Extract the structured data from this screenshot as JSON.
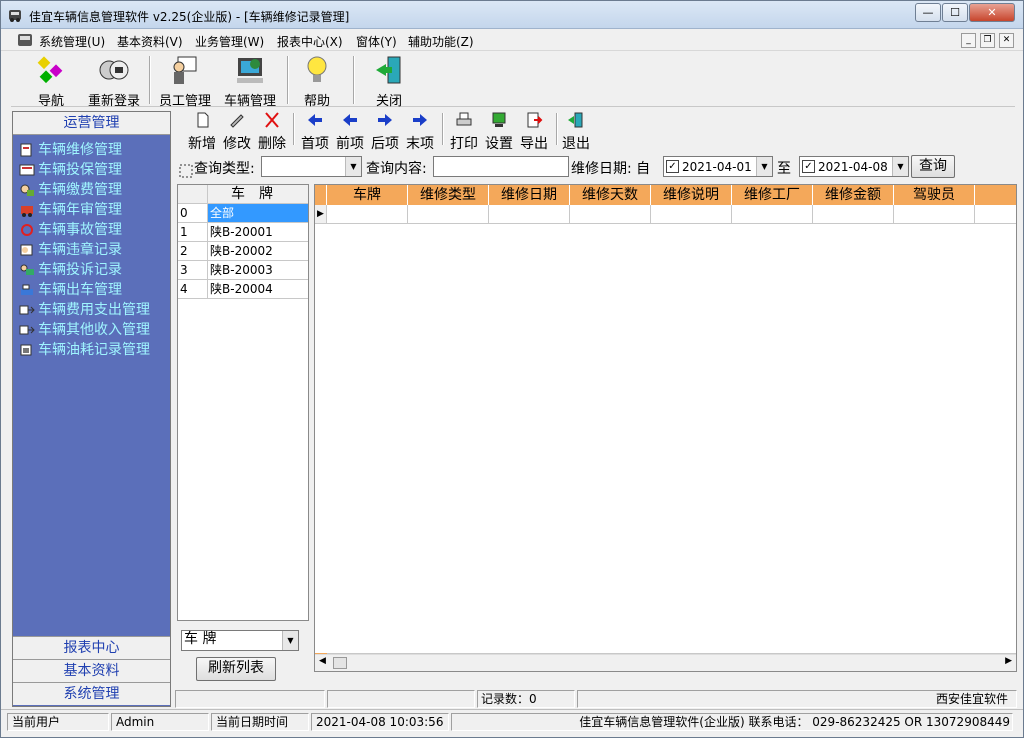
{
  "window": {
    "title": "佳宜车辆信息管理软件 v2.25(企业版)  - [车辆维修记录管理]"
  },
  "menu": [
    "系统管理(U)",
    "基本资料(V)",
    "业务管理(W)",
    "报表中心(X)",
    "窗体(Y)",
    "辅助功能(Z)"
  ],
  "toolbar": [
    "导航",
    "重新登录",
    "员工管理",
    "车辆管理",
    "帮助",
    "关闭"
  ],
  "sidebar": {
    "header": "运营管理",
    "items": [
      "车辆维修管理",
      "车辆投保管理",
      "车辆缴费管理",
      "车辆年审管理",
      "车辆事故管理",
      "车辆违章记录",
      "车辆投诉记录",
      "车辆出车管理",
      "车辆费用支出管理",
      "车辆其他收入管理",
      "车辆油耗记录管理"
    ],
    "footer": [
      "报表中心",
      "基本资料",
      "系统管理"
    ]
  },
  "subtoolbar": [
    "新增",
    "修改",
    "删除",
    "首项",
    "前项",
    "后项",
    "末项",
    "打印",
    "设置",
    "导出",
    "退出"
  ],
  "query": {
    "type_label": "查询类型:",
    "content_label": "查询内容:",
    "date_label": "维修日期: 自",
    "date_from": "2021-04-01",
    "to_label": "至",
    "date_to": "2021-04-08",
    "query_button": "查询"
  },
  "plate_list": {
    "header": "车牌",
    "rows": [
      {
        "n": "0",
        "p": "全部"
      },
      {
        "n": "1",
        "p": "陕B-20001"
      },
      {
        "n": "2",
        "p": "陕B-20002"
      },
      {
        "n": "3",
        "p": "陕B-20003"
      },
      {
        "n": "4",
        "p": "陕B-20004"
      }
    ],
    "filter_value": "车    牌",
    "refresh_button": "刷新列表"
  },
  "records_grid": {
    "columns": [
      "车牌",
      "维修类型",
      "维修日期",
      "维修天数",
      "维修说明",
      "维修工厂",
      "维修金额",
      "驾驶员",
      "备"
    ]
  },
  "info": {
    "record_count": "记录数：0",
    "company": "西安佳宜软件"
  },
  "status": {
    "user_label": "当前用户",
    "user": "Admin",
    "time_label": "当前日期时间",
    "time": "2021-04-08 10:03:56",
    "product": "佳宜车辆信息管理软件(企业版)  联系电话：  029-86232425  OR  13072908449"
  },
  "colors": {
    "sidebar_bg": "#5b6fba",
    "sidebar_text": "#9ff5ff",
    "grid_header": "#f4a85a"
  }
}
